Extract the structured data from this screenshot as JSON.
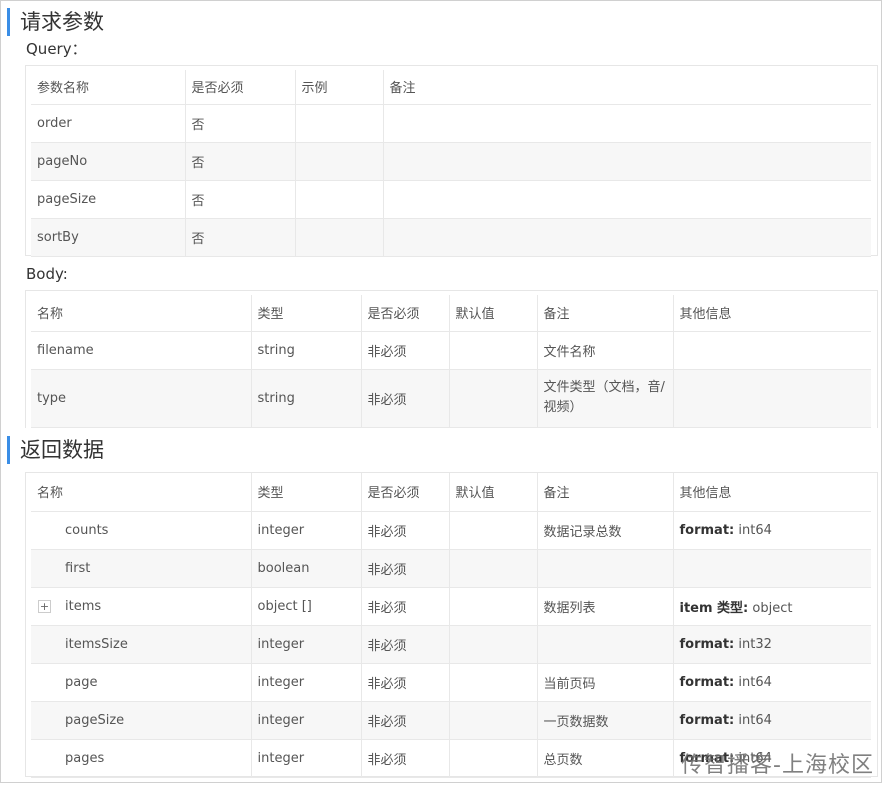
{
  "request": {
    "title": "请求参数",
    "query_label": "Query：",
    "query_headers": [
      "参数名称",
      "是否必须",
      "示例",
      "备注"
    ],
    "query_rows": [
      [
        "order",
        "否",
        "",
        ""
      ],
      [
        "pageNo",
        "否",
        "",
        ""
      ],
      [
        "pageSize",
        "否",
        "",
        ""
      ],
      [
        "sortBy",
        "否",
        "",
        ""
      ]
    ],
    "body_label": "Body:",
    "body_headers": [
      "名称",
      "类型",
      "是否必须",
      "默认值",
      "备注",
      "其他信息"
    ],
    "body_rows": [
      [
        "filename",
        "string",
        "非必须",
        "",
        "文件名称",
        ""
      ],
      [
        "type",
        "string",
        "非必须",
        "",
        "文件类型（文档，音/视频）",
        ""
      ]
    ]
  },
  "response": {
    "title": "返回数据",
    "headers": [
      "名称",
      "类型",
      "是否必须",
      "默认值",
      "备注",
      "其他信息"
    ],
    "rows": [
      {
        "name": "counts",
        "type": "integer",
        "required": "非必须",
        "default": "",
        "note": "数据记录总数",
        "info_label": "format:",
        "info_value": " int64",
        "expandable": false
      },
      {
        "name": "first",
        "type": "boolean",
        "required": "非必须",
        "default": "",
        "note": "",
        "info_label": "",
        "info_value": "",
        "expandable": false
      },
      {
        "name": "items",
        "type": "object []",
        "required": "非必须",
        "default": "",
        "note": "数据列表",
        "info_label": "item 类型:",
        "info_value": " object",
        "expandable": true
      },
      {
        "name": "itemsSize",
        "type": "integer",
        "required": "非必须",
        "default": "",
        "note": "",
        "info_label": "format:",
        "info_value": " int32",
        "expandable": false
      },
      {
        "name": "page",
        "type": "integer",
        "required": "非必须",
        "default": "",
        "note": "当前页码",
        "info_label": "format:",
        "info_value": " int64",
        "expandable": false
      },
      {
        "name": "pageSize",
        "type": "integer",
        "required": "非必须",
        "default": "",
        "note": "一页数据数",
        "info_label": "format:",
        "info_value": " int64",
        "expandable": false
      },
      {
        "name": "pages",
        "type": "integer",
        "required": "非必须",
        "default": "",
        "note": "总页数",
        "info_label": "format:",
        "info_value": " int64",
        "expandable": false
      }
    ],
    "expand_symbol": "+"
  },
  "watermark": "传智播客-上海校区"
}
